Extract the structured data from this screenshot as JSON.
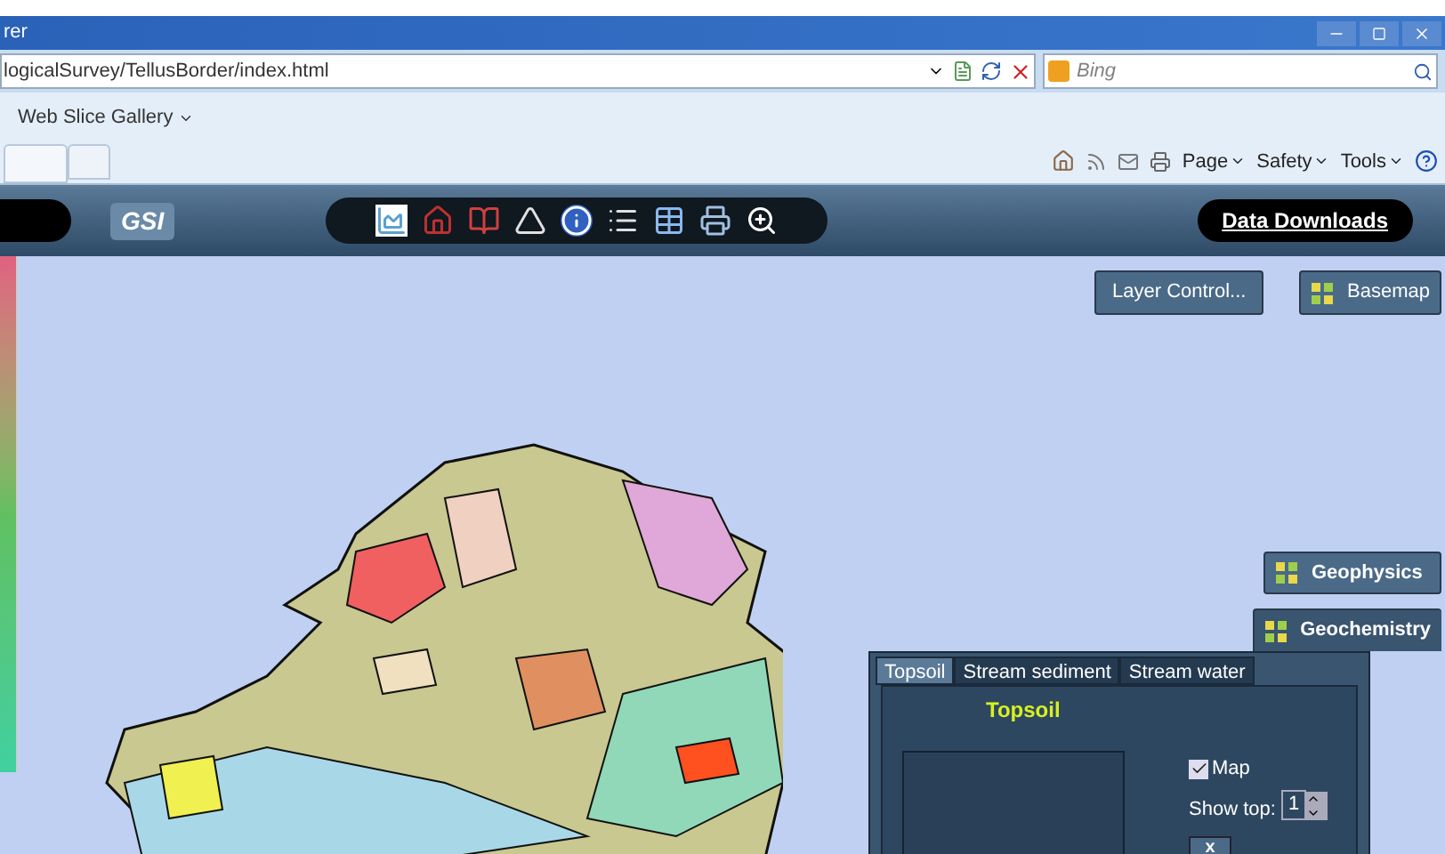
{
  "window": {
    "title": "rer"
  },
  "address_bar": {
    "url": "logicalSurvey/TellusBorder/index.html"
  },
  "search": {
    "placeholder": "Bing"
  },
  "favorites_bar": {
    "items": [
      "Web Slice Gallery"
    ]
  },
  "command_bar": {
    "menus": [
      "Page",
      "Safety",
      "Tools"
    ]
  },
  "app_header": {
    "logo": "GSI",
    "data_downloads": "Data Downloads"
  },
  "map_controls": {
    "layer_control": "Layer Control...",
    "basemap": "Basemap"
  },
  "side_buttons": [
    {
      "label": "Geophysics",
      "selected": false
    },
    {
      "label": "Geochemistry",
      "selected": true
    }
  ],
  "panel": {
    "tabs": [
      {
        "label": "Topsoil",
        "selected": true
      },
      {
        "label": "Stream sediment",
        "selected": false
      },
      {
        "label": "Stream water",
        "selected": false
      }
    ],
    "title": "Topsoil",
    "map_checkbox": {
      "label": "Map",
      "checked": true
    },
    "show_top": {
      "label": "Show top:",
      "value": "1"
    },
    "close": "x"
  }
}
